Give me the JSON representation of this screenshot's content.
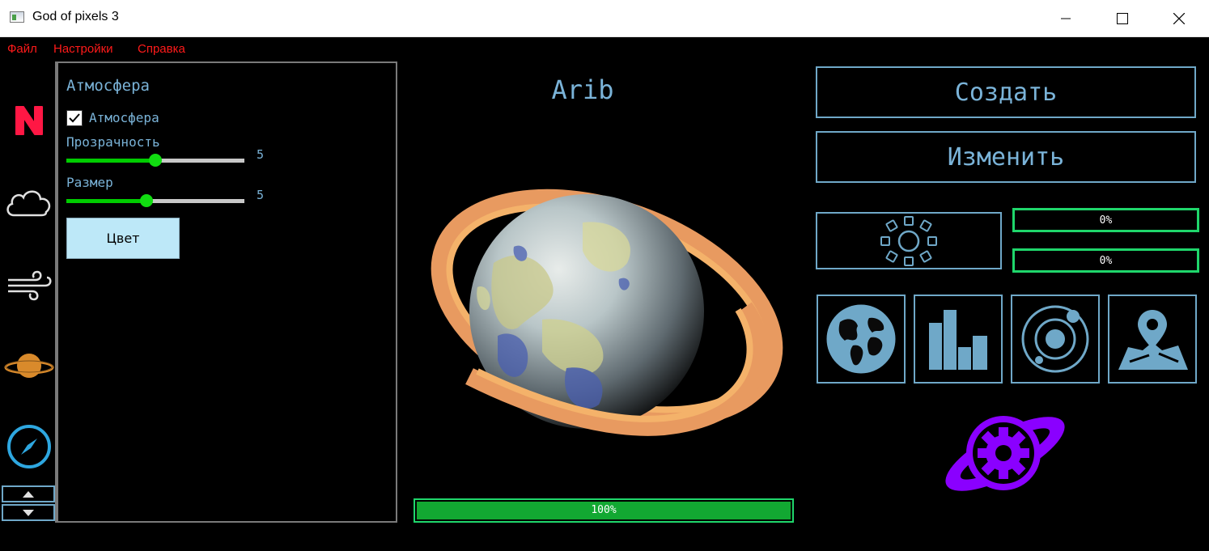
{
  "window": {
    "title": "God of pixels 3",
    "min_icon": "minimize-icon",
    "max_icon": "maximize-icon",
    "close_icon": "close-icon"
  },
  "menu": {
    "items": [
      "Файл",
      "Настройки",
      "Справка"
    ],
    "color": "#ff1a1a"
  },
  "sidebar": {
    "items": [
      {
        "icon": "n-logo-icon",
        "color": "#ff1744"
      },
      {
        "icon": "cloud-icon",
        "color": "#e0e0e0"
      },
      {
        "icon": "wind-icon",
        "color": "#e0e0e0"
      },
      {
        "icon": "saturn-icon",
        "color": "#d98a2b"
      },
      {
        "icon": "compass-icon",
        "color": "#2ea7e0"
      }
    ],
    "scroll_up": "arrow-up-icon",
    "scroll_down": "arrow-down-icon"
  },
  "panel": {
    "title": "Атмосфера",
    "checkbox": {
      "label": "Атмосфера",
      "checked": true
    },
    "sliders": [
      {
        "label": "Прозрачность",
        "value": "5",
        "level": 0.5
      },
      {
        "label": "Размер",
        "value": "5",
        "level": 0.45
      }
    ],
    "color_button": "Цвет"
  },
  "planet": {
    "name": "Arib"
  },
  "main_progress": {
    "text": "100%",
    "value": 1.0
  },
  "actions": {
    "create": "Создать",
    "modify": "Изменить"
  },
  "generator": {
    "icon": "sun-gear-icon"
  },
  "small_progress": [
    {
      "text": "0%",
      "value": 0
    },
    {
      "text": "0%",
      "value": 0
    }
  ],
  "tools": [
    {
      "icon": "globe-icon"
    },
    {
      "icon": "bar-chart-icon"
    },
    {
      "icon": "orbit-icon"
    },
    {
      "icon": "map-pin-icon"
    }
  ],
  "settings_logo": {
    "icon": "planet-gear-icon",
    "color": "#8a00ff"
  },
  "colors": {
    "accent": "#7ab3d8",
    "border": "#6fa8c8",
    "progress_border": "#1fd66b",
    "progress_fill": "#12a832"
  }
}
